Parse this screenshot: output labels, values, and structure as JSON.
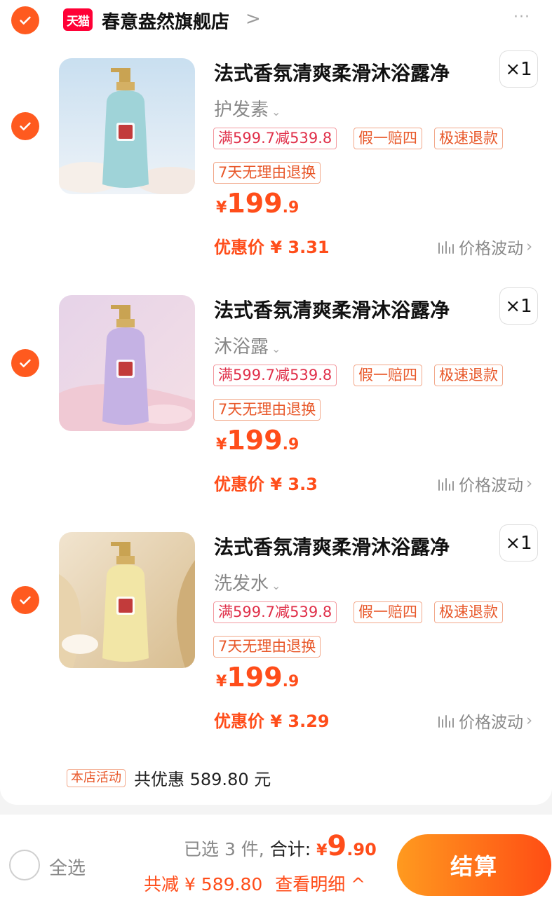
{
  "store": {
    "badge": "天猫",
    "name": "春意盎然旗舰店",
    "chevron": ">",
    "more": "···"
  },
  "items": [
    {
      "title": "法式香氛清爽柔滑沐浴露净",
      "quantity": "×1",
      "variant": "护发素",
      "tags": [
        "满599.7减539.8",
        "假一赔四",
        "极速退款",
        "7天无理由退换"
      ],
      "price_yen": "¥",
      "price_int": "199",
      "price_dec": ".9",
      "promo": "优惠价 ¥ 3.31",
      "wave_label": "价格波动",
      "bottle_color": "#9fd3d8"
    },
    {
      "title": "法式香氛清爽柔滑沐浴露净",
      "quantity": "×1",
      "variant": "沐浴露",
      "tags": [
        "满599.7减539.8",
        "假一赔四",
        "极速退款",
        "7天无理由退换"
      ],
      "price_yen": "¥",
      "price_int": "199",
      "price_dec": ".9",
      "promo": "优惠价 ¥ 3.3",
      "wave_label": "价格波动",
      "bottle_color": "#c5b2e4"
    },
    {
      "title": "法式香氛清爽柔滑沐浴露净",
      "quantity": "×1",
      "variant": "洗发水",
      "tags": [
        "满599.7减539.8",
        "假一赔四",
        "极速退款",
        "7天无理由退换"
      ],
      "price_yen": "¥",
      "price_int": "199",
      "price_dec": ".9",
      "promo": "优惠价 ¥ 3.29",
      "wave_label": "价格波动",
      "bottle_color": "#f2e6a6"
    }
  ],
  "activity": {
    "tag": "本店活动",
    "text": "共优惠 589.80 元"
  },
  "footer": {
    "select_all": "全选",
    "selected": "已选 3 件,",
    "total_label": "合计:",
    "total_yen": "¥",
    "total_int": "9",
    "total_dec": ".90",
    "savings": "共减 ¥ 589.80",
    "details": "查看明细 ^",
    "checkout": "结算"
  },
  "colors": {
    "accent": "#ff4d1a",
    "check": "#ff5a1f",
    "tmall_red": "#ff0036"
  }
}
